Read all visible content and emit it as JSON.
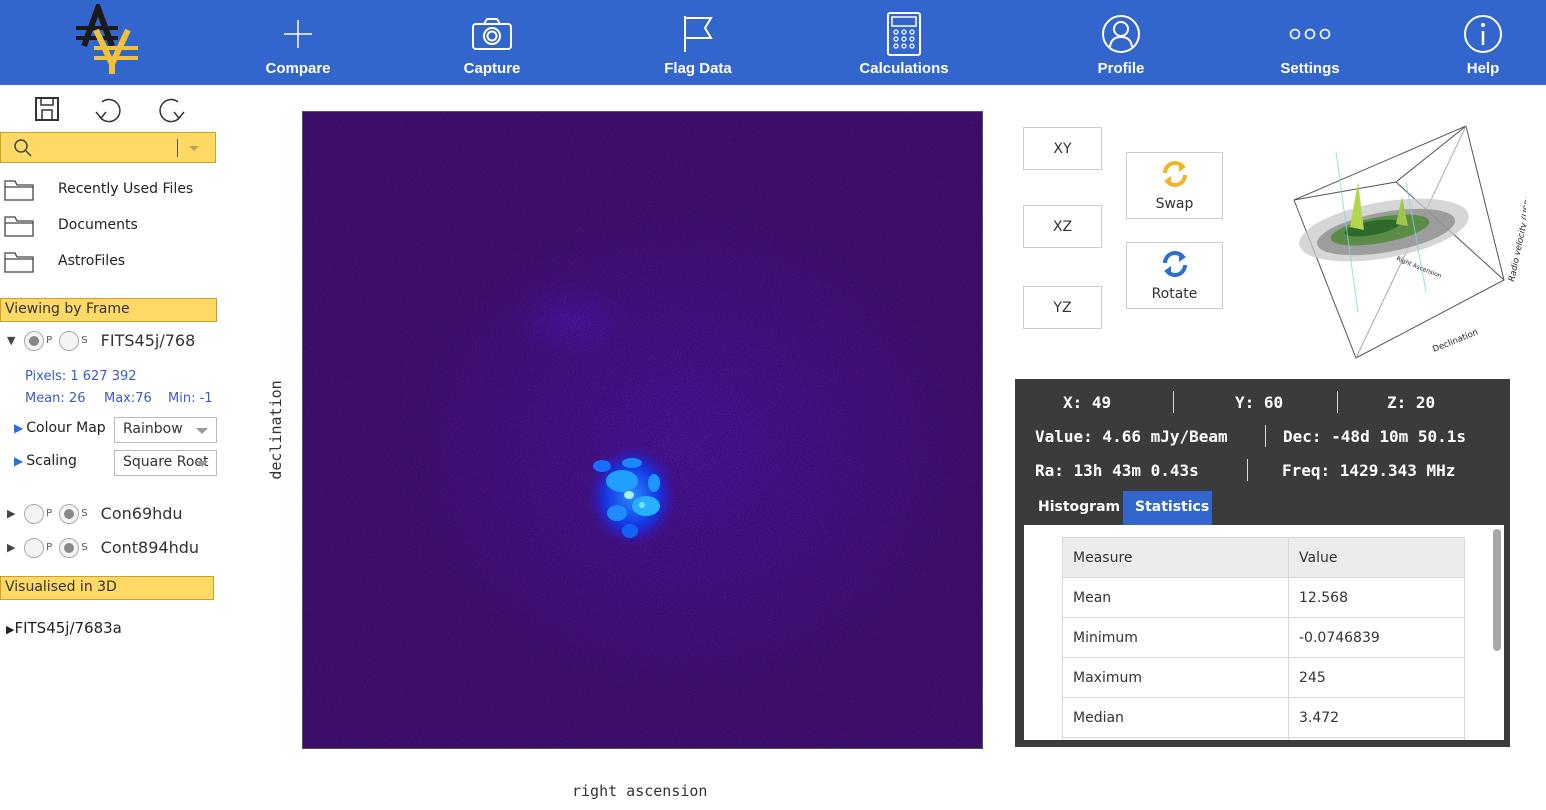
{
  "app": {
    "nav": [
      {
        "key": "compare",
        "label": "Compare",
        "icon": "plus-icon"
      },
      {
        "key": "capture",
        "label": "Capture",
        "icon": "camera-icon"
      },
      {
        "key": "flag",
        "label": "Flag Data",
        "icon": "flag-icon"
      },
      {
        "key": "calc",
        "label": "Calculations",
        "icon": "calculator-icon"
      },
      {
        "key": "profile",
        "label": "Profile",
        "icon": "user-icon"
      },
      {
        "key": "settings",
        "label": "Settings",
        "icon": "ellipsis-icon"
      },
      {
        "key": "help",
        "label": "Help",
        "icon": "info-icon"
      }
    ],
    "colors": {
      "nav_bg": "#3366cc",
      "highlight": "#ffd966",
      "logo_black": "#1a1a1a",
      "logo_gold": "#f2c13a"
    }
  },
  "sidebar": {
    "toolbar": {
      "save_icon": "save-icon",
      "undo_icon": "undo-icon",
      "redo_icon": "redo-icon"
    },
    "search": {
      "value": "",
      "icon": "search-icon"
    },
    "folders": [
      "Recently Used Files",
      "Documents",
      "AstroFiles"
    ],
    "viewing_header": "Viewing by Frame",
    "frames": [
      {
        "name": "FITS45j/768",
        "expanded": true,
        "p": true,
        "s": false,
        "p_label": "P",
        "s_label": "S"
      },
      {
        "name": "Con69hdu",
        "expanded": false,
        "p": false,
        "s": true,
        "p_label": "P",
        "s_label": "S"
      },
      {
        "name": "Cont894hdu",
        "expanded": false,
        "p": false,
        "s": true,
        "p_label": "P",
        "s_label": "S"
      }
    ],
    "frame_stats": {
      "pixels": "Pixels: 1 627 392",
      "mean": "Mean: 26",
      "max": "Max:76",
      "min": "Min: -1"
    },
    "colour_map": {
      "label": "Colour Map",
      "value": "Rainbow"
    },
    "scaling": {
      "label": "Scaling",
      "value": "Square Root"
    },
    "visualised_header": "Visualised in 3D",
    "visualised_item": "FITS45j/7683a"
  },
  "main": {
    "xlabel": "right ascension",
    "ylabel": "declination"
  },
  "views": {
    "xy": "XY",
    "xz": "XZ",
    "yz": "YZ",
    "swap": "Swap",
    "rotate": "Rotate"
  },
  "cube": {
    "axis_velocity": "Radio velocity (USB) (km/s)",
    "axis_dec": "Declination",
    "axis_ra": "Right Ascension"
  },
  "readout": {
    "x": "X: 49",
    "y": "Y: 60",
    "z": "Z: 20",
    "value": "Value: 4.66 mJy/Beam",
    "dec": "Dec: -48d 10m 50.1s",
    "ra": "Ra: 13h 43m 0.43s",
    "freq": "Freq: 1429.343 MHz"
  },
  "tabs": {
    "histogram": "Histogram",
    "statistics": "Statistics",
    "active": "statistics"
  },
  "stats": {
    "headers": [
      "Measure",
      "Value"
    ],
    "rows": [
      [
        "Mean",
        "12.568"
      ],
      [
        "Minimum",
        "-0.0746839"
      ],
      [
        "Maximum",
        "245"
      ],
      [
        "Median",
        "3.472"
      ],
      [
        "",
        ""
      ]
    ]
  }
}
